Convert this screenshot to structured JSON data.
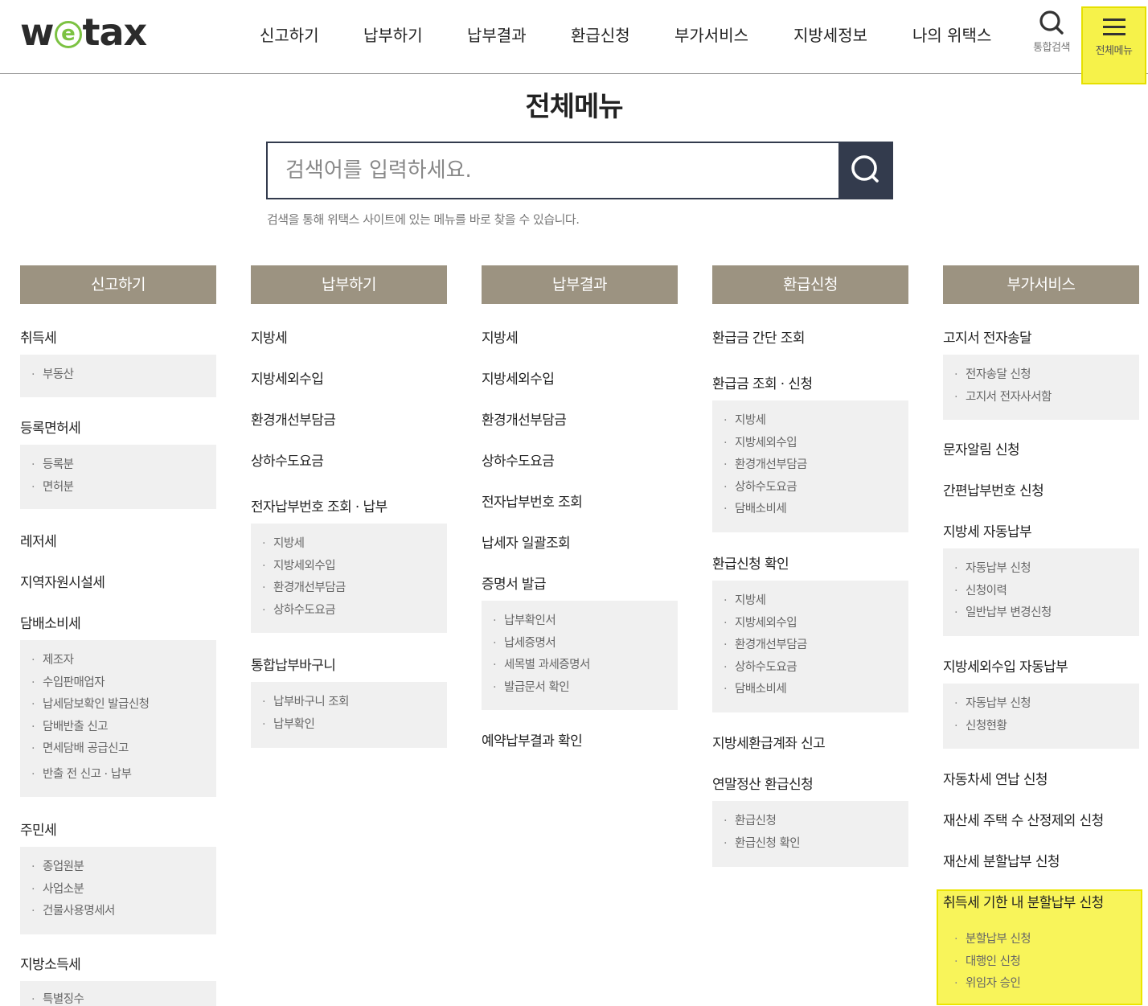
{
  "header": {
    "logo": {
      "pre": "w",
      "mid": "e",
      "post": "tax"
    },
    "nav": [
      "신고하기",
      "납부하기",
      "납부결과",
      "환급신청",
      "부가서비스",
      "지방세정보",
      "나의 위택스"
    ],
    "search_label": "통합검색",
    "menu_label": "전체메뉴"
  },
  "page": {
    "title": "전체메뉴",
    "search_placeholder": "검색어를 입력하세요.",
    "search_hint": "검색을 통해 위택스 사이트에 있는 메뉴를 바로 찾을 수 있습니다."
  },
  "columns": [
    {
      "title": "신고하기",
      "sections": [
        {
          "title": "취득세",
          "items": [
            "부동산"
          ]
        },
        {
          "title": "등록면허세",
          "items": [
            "등록분",
            "면허분"
          ]
        },
        {
          "title": "레저세",
          "items": []
        },
        {
          "title": "지역자원시설세",
          "items": []
        },
        {
          "title": "담배소비세",
          "items": [
            "제조자",
            "수입판매업자",
            "납세담보확인 발급신청",
            "담배반출 신고",
            "면세담배 공급신고",
            "반출 전 신고 · 납부"
          ]
        },
        {
          "title": "주민세",
          "items": [
            "종업원분",
            "사업소분",
            "건물사용명세서"
          ]
        },
        {
          "title": "지방소득세",
          "items": [
            "특별징수"
          ]
        }
      ]
    },
    {
      "title": "납부하기",
      "sections": [
        {
          "title": "지방세",
          "items": []
        },
        {
          "title": "지방세외수입",
          "items": []
        },
        {
          "title": "환경개선부담금",
          "items": []
        },
        {
          "title": "상하수도요금",
          "items": []
        },
        {
          "title": "전자납부번호 조회 · 납부",
          "items": [
            "지방세",
            "지방세외수입",
            "환경개선부담금",
            "상하수도요금"
          ]
        },
        {
          "title": "통합납부바구니",
          "items": [
            "납부바구니 조회",
            "납부확인"
          ]
        }
      ]
    },
    {
      "title": "납부결과",
      "sections": [
        {
          "title": "지방세",
          "items": []
        },
        {
          "title": "지방세외수입",
          "items": []
        },
        {
          "title": "환경개선부담금",
          "items": []
        },
        {
          "title": "상하수도요금",
          "items": []
        },
        {
          "title": "전자납부번호 조회",
          "items": []
        },
        {
          "title": "납세자 일괄조회",
          "items": []
        },
        {
          "title": "증명서 발급",
          "items": [
            "납부확인서",
            "납세증명서",
            "세목별 과세증명서",
            "발급문서 확인"
          ]
        },
        {
          "title": "예약납부결과 확인",
          "items": []
        }
      ]
    },
    {
      "title": "환급신청",
      "sections": [
        {
          "title": "환급금 간단 조회",
          "items": []
        },
        {
          "title": "환급금 조회 · 신청",
          "items": [
            "지방세",
            "지방세외수입",
            "환경개선부담금",
            "상하수도요금",
            "담배소비세"
          ]
        },
        {
          "title": "환급신청 확인",
          "items": [
            "지방세",
            "지방세외수입",
            "환경개선부담금",
            "상하수도요금",
            "담배소비세"
          ]
        },
        {
          "title": "지방세환급계좌 신고",
          "items": []
        },
        {
          "title": "연말정산 환급신청",
          "items": [
            "환급신청",
            "환급신청 확인"
          ]
        }
      ]
    },
    {
      "title": "부가서비스",
      "sections": [
        {
          "title": "고지서 전자송달",
          "items": [
            "전자송달 신청",
            "고지서 전자사서함"
          ]
        },
        {
          "title": "문자알림 신청",
          "items": []
        },
        {
          "title": "간편납부번호 신청",
          "items": []
        },
        {
          "title": "지방세 자동납부",
          "items": [
            "자동납부 신청",
            "신청이력",
            "일반납부 변경신청"
          ]
        },
        {
          "title": "지방세외수입 자동납부",
          "items": [
            "자동납부 신청",
            "신청현황"
          ]
        },
        {
          "title": "자동차세 연납 신청",
          "items": []
        },
        {
          "title": "재산세 주택 수 산정제외 신청",
          "items": []
        },
        {
          "title": "재산세 분할납부 신청",
          "items": []
        },
        {
          "title": "취득세 기한 내 분할납부 신청",
          "items": [
            "분할납부 신청",
            "대행인 신청",
            "위임자 승인"
          ]
        }
      ]
    }
  ]
}
